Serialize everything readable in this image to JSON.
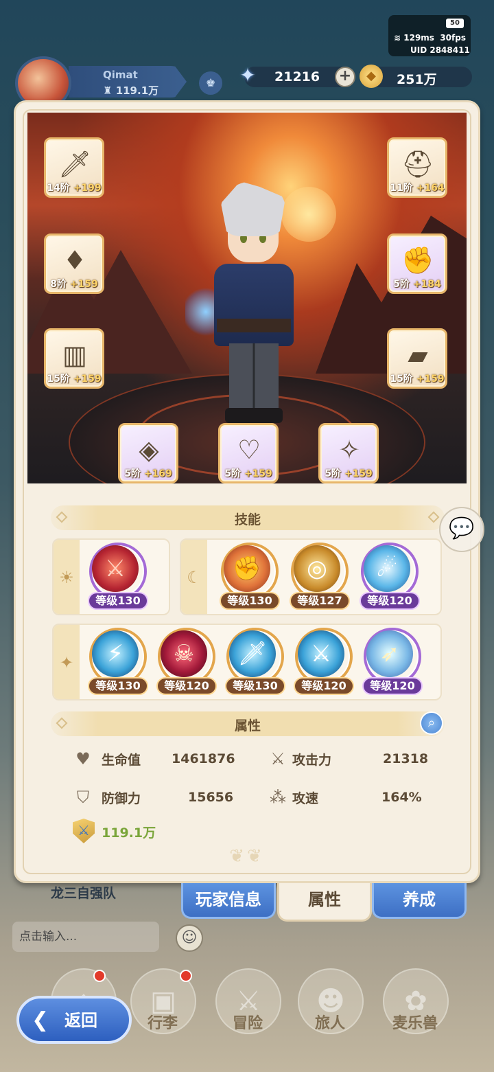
{
  "status": {
    "battery": "50",
    "ping": "129ms",
    "fps": "30fps",
    "uid": "UID  2848411"
  },
  "player": {
    "name": "Qimat",
    "power": "119.1万"
  },
  "currency": {
    "gems": "21216",
    "gold": "251万"
  },
  "equipment": [
    {
      "name": "weapon",
      "tier": "14阶",
      "bonus": "+199"
    },
    {
      "name": "helmet",
      "tier": "11阶",
      "bonus": "+164"
    },
    {
      "name": "armor",
      "tier": "8阶",
      "bonus": "+159"
    },
    {
      "name": "gloves",
      "tier": "5阶",
      "bonus": "+184"
    },
    {
      "name": "pants",
      "tier": "15阶",
      "bonus": "+159"
    },
    {
      "name": "boots",
      "tier": "15阶",
      "bonus": "+159"
    },
    {
      "name": "ring",
      "tier": "5阶",
      "bonus": "+169"
    },
    {
      "name": "necklace",
      "tier": "5阶",
      "bonus": "+159"
    },
    {
      "name": "amulet",
      "tier": "5阶",
      "bonus": "+159"
    }
  ],
  "skills": {
    "title": "技能",
    "group1": [
      {
        "level": "等级130"
      }
    ],
    "group2": [
      {
        "level": "等级130"
      },
      {
        "level": "等级127"
      },
      {
        "level": "等级120"
      }
    ],
    "group3": [
      {
        "level": "等级130"
      },
      {
        "level": "等级120"
      },
      {
        "level": "等级130"
      },
      {
        "level": "等级120"
      },
      {
        "level": "等级120"
      }
    ]
  },
  "attributes": {
    "title": "属性",
    "hp_label": "生命值",
    "hp": "1461876",
    "atk_label": "攻击力",
    "atk": "21318",
    "def_label": "防御力",
    "def": "15656",
    "spd_label": "攻速",
    "spd": "164%",
    "power": "119.1万"
  },
  "tabs": [
    "玩家信息",
    "属性",
    "养成"
  ],
  "guild": "龙三自强队",
  "chat": {
    "placeholder": "点击输入..."
  },
  "nav": [
    "行李",
    "冒险",
    "旅人",
    "麦乐兽"
  ],
  "back_label": "返回",
  "colors": {
    "accent_blue": "#3d6fc4",
    "gold_border": "#e7b66a",
    "power_green": "#7aa53a"
  }
}
